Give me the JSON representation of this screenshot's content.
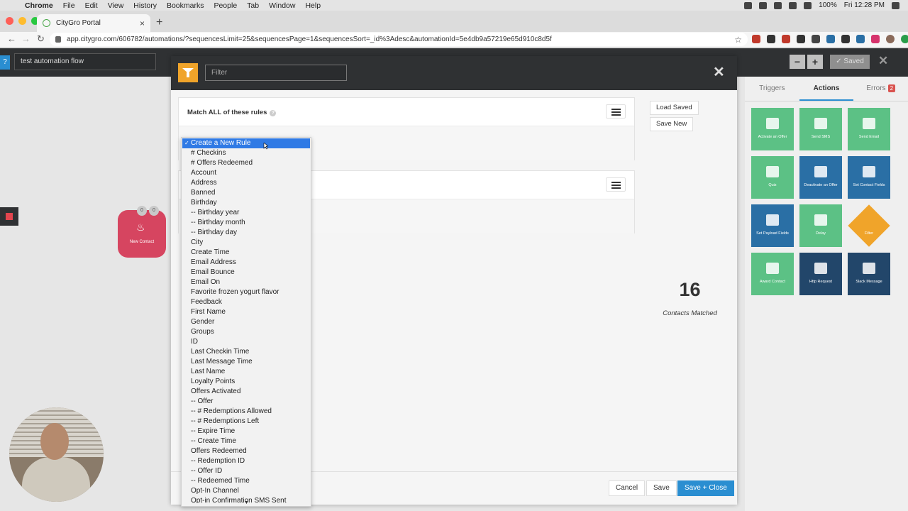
{
  "macos": {
    "app_name": "Chrome",
    "menus": [
      "File",
      "Edit",
      "View",
      "History",
      "Bookmarks",
      "People",
      "Tab",
      "Window",
      "Help"
    ],
    "battery": "100%",
    "clock": "Fri 12:28 PM"
  },
  "browser": {
    "tab_title": "CityGro Portal",
    "url": "app.citygro.com/606782/automations/?sequencesLimit=25&sequencesPage=1&sequencesSort=_id%3Adesc&automationId=5e4db9a57219e65d910c8d5f"
  },
  "app": {
    "automation_name": "test automation flow",
    "zoom_out": "−",
    "zoom_in": "+",
    "saved_label": "Saved",
    "canvas_node": {
      "label": "New Contact",
      "badge_a": "0",
      "badge_b": "0"
    }
  },
  "right_panel": {
    "tabs": [
      {
        "label": "Triggers"
      },
      {
        "label": "Actions"
      },
      {
        "label": "Errors",
        "count": "2"
      }
    ],
    "tiles": [
      {
        "label": "Activate an Offer",
        "color": "#5cc185"
      },
      {
        "label": "Send SMS",
        "color": "#5cc185"
      },
      {
        "label": "Send Email",
        "color": "#5cc185"
      },
      {
        "label": "Quiz",
        "color": "#5cc185"
      },
      {
        "label": "Deactivate an Offer",
        "color": "#2a6fa5"
      },
      {
        "label": "Set Contact Fields",
        "color": "#2a6fa5"
      },
      {
        "label": "Set Payload Fields",
        "color": "#2a6fa5"
      },
      {
        "label": "Delay",
        "color": "#5cc185"
      },
      {
        "label": "Filter",
        "color": "#f0a42a"
      },
      {
        "label": "Award Contact",
        "color": "#5cc185"
      },
      {
        "label": "Http Request",
        "color": "#22466a"
      },
      {
        "label": "Slack Message",
        "color": "#22466a"
      }
    ]
  },
  "modal": {
    "filter_placeholder": "Filter",
    "rule_title": "Match ALL of these rules",
    "load_saved": "Load Saved",
    "save_new": "Save New",
    "contacts_count": "16",
    "contacts_label": "Contacts Matched",
    "cancel": "Cancel",
    "save": "Save",
    "save_close": "Save + Close"
  },
  "dropdown": {
    "selected": "Create a New Rule",
    "options": [
      "# Checkins",
      "# Offers Redeemed",
      "Account",
      "Address",
      "Banned",
      "Birthday",
      "-- Birthday year",
      "-- Birthday month",
      "-- Birthday day",
      "City",
      "Create Time",
      "Email Address",
      "Email Bounce",
      "Email On",
      "Favorite frozen yogurt flavor",
      "Feedback",
      "First Name",
      "Gender",
      "Groups",
      "ID",
      "Last Checkin Time",
      "Last Message Time",
      "Last Name",
      "Loyalty Points",
      "Offers Activated",
      "-- Offer",
      "-- # Redemptions Allowed",
      "-- # Redemptions Left",
      "-- Expire Time",
      "-- Create Time",
      "Offers Redeemed",
      "-- Redemption ID",
      "-- Offer ID",
      "-- Redeemed Time",
      "Opt-In Channel"
    ],
    "partial_option": "Opt-in Confirmation SMS Sent"
  }
}
